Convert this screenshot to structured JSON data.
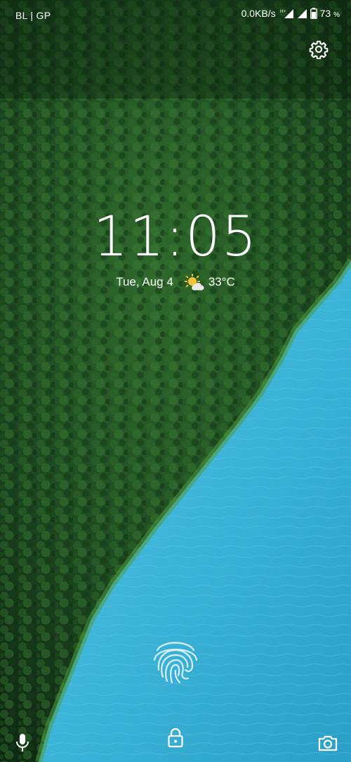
{
  "status_bar": {
    "carrier": "BL | GP",
    "net_speed": "0.0KB/s",
    "battery_percent": "73",
    "battery_unit": "%",
    "battery_level": 0.73,
    "network_type": "H+"
  },
  "lock_screen": {
    "time": "11:05",
    "date": "Tue, Aug 4",
    "temperature": "33°C",
    "weather_icon": "partly-cloudy-icon"
  },
  "icons": {
    "settings": "gear-icon",
    "fingerprint": "fingerprint-icon",
    "voice": "microphone-icon",
    "unlock": "lock-icon",
    "camera": "camera-icon"
  },
  "colors": {
    "forest": "#1f4d24",
    "water": "#3fb8db",
    "text": "#ffffff"
  }
}
